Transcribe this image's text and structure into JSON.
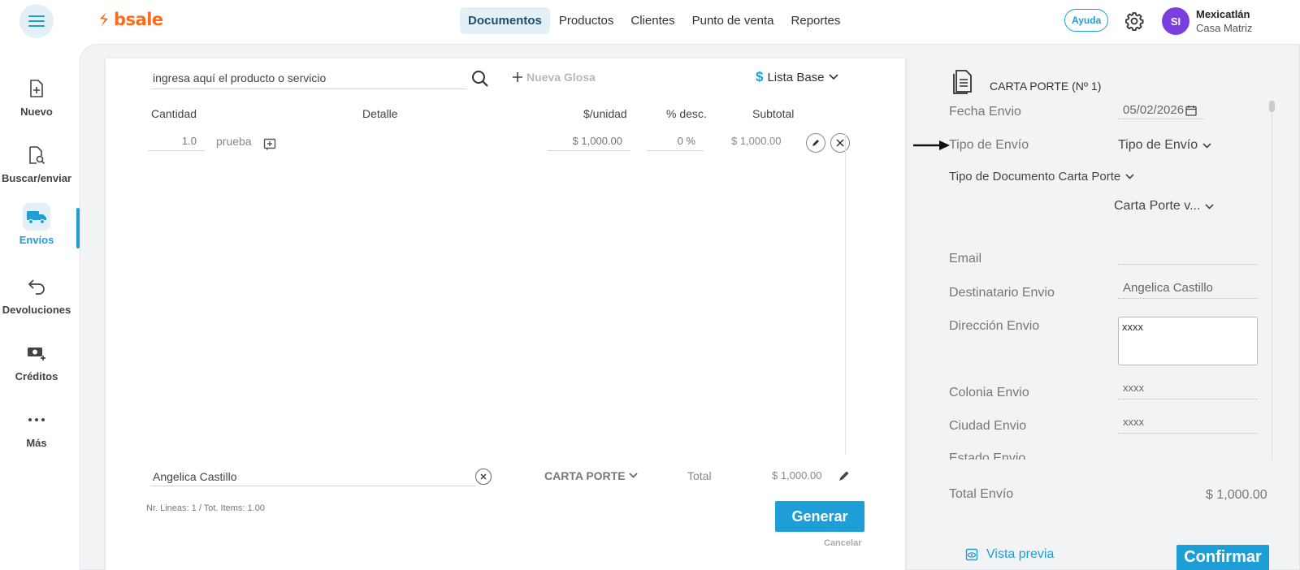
{
  "header": {
    "logo_text": "bsale",
    "nav": [
      {
        "label": "Documentos",
        "active": true
      },
      {
        "label": "Productos"
      },
      {
        "label": "Clientes"
      },
      {
        "label": "Punto de venta"
      },
      {
        "label": "Reportes"
      }
    ],
    "help_label": "Ayuda",
    "avatar_initials": "SI",
    "user_name": "Mexicatlán",
    "user_branch": "Casa Matriz"
  },
  "sidebar": {
    "items": [
      {
        "label": "Nuevo"
      },
      {
        "label": "Buscar/enviar"
      },
      {
        "label": "Envíos",
        "active": true
      },
      {
        "label": "Devoluciones"
      },
      {
        "label": "Créditos"
      },
      {
        "label": "Más"
      }
    ]
  },
  "editor": {
    "search_placeholder": "ingresa aquí el producto o servicio",
    "nueva_glosa": "Nueva Glosa",
    "price_list_symbol": "$",
    "price_list": "Lista Base",
    "columns": {
      "cantidad": "Cantidad",
      "detalle": "Detalle",
      "unidad": "$/unidad",
      "desc": "% desc.",
      "subtotal": "Subtotal"
    },
    "rows": [
      {
        "cantidad": "1.0",
        "detalle": "prueba",
        "unidad": "$ 1,000.00",
        "desc": "0 %",
        "subtotal": "$ 1,000.00"
      }
    ],
    "client": "Angelica Castillo",
    "document_type": "CARTA PORTE",
    "total_label": "Total",
    "total_value": "$ 1,000.00",
    "summary": "Nr. Lineas: 1 / Tot. Items: 1.00",
    "generar_label": "Generar",
    "cancelar_label": "Cancelar"
  },
  "panel": {
    "title": "CARTA PORTE (Nº 1)",
    "fecha_label": "Fecha Envio",
    "fecha_value": "05/02/2026",
    "tipo_envio_label": "Tipo de Envío",
    "tipo_envio_value": "Tipo de Envío",
    "tipo_doc_label": "Tipo de Documento Carta Porte",
    "tipo_doc_value": "Carta Porte v...",
    "email_label": "Email",
    "email_value": "",
    "destinatario_label": "Destinatario Envio",
    "destinatario_value": "Angelica Castillo",
    "direccion_label": "Dirección Envio",
    "direccion_value": "xxxx",
    "colonia_label": "Colonia Envio",
    "colonia_value": "xxxx",
    "ciudad_label": "Ciudad Envio",
    "ciudad_value": "xxxx",
    "estado_label": "Estado Envio",
    "total_label": "Total Envío",
    "total_value": "$ 1,000.00",
    "vista_previa": "Vista previa",
    "confirmar": "Confirmar"
  },
  "colors": {
    "accent": "#1e9ed6",
    "brand": "#ff6b1a",
    "avatar": "#7b3fe0"
  }
}
